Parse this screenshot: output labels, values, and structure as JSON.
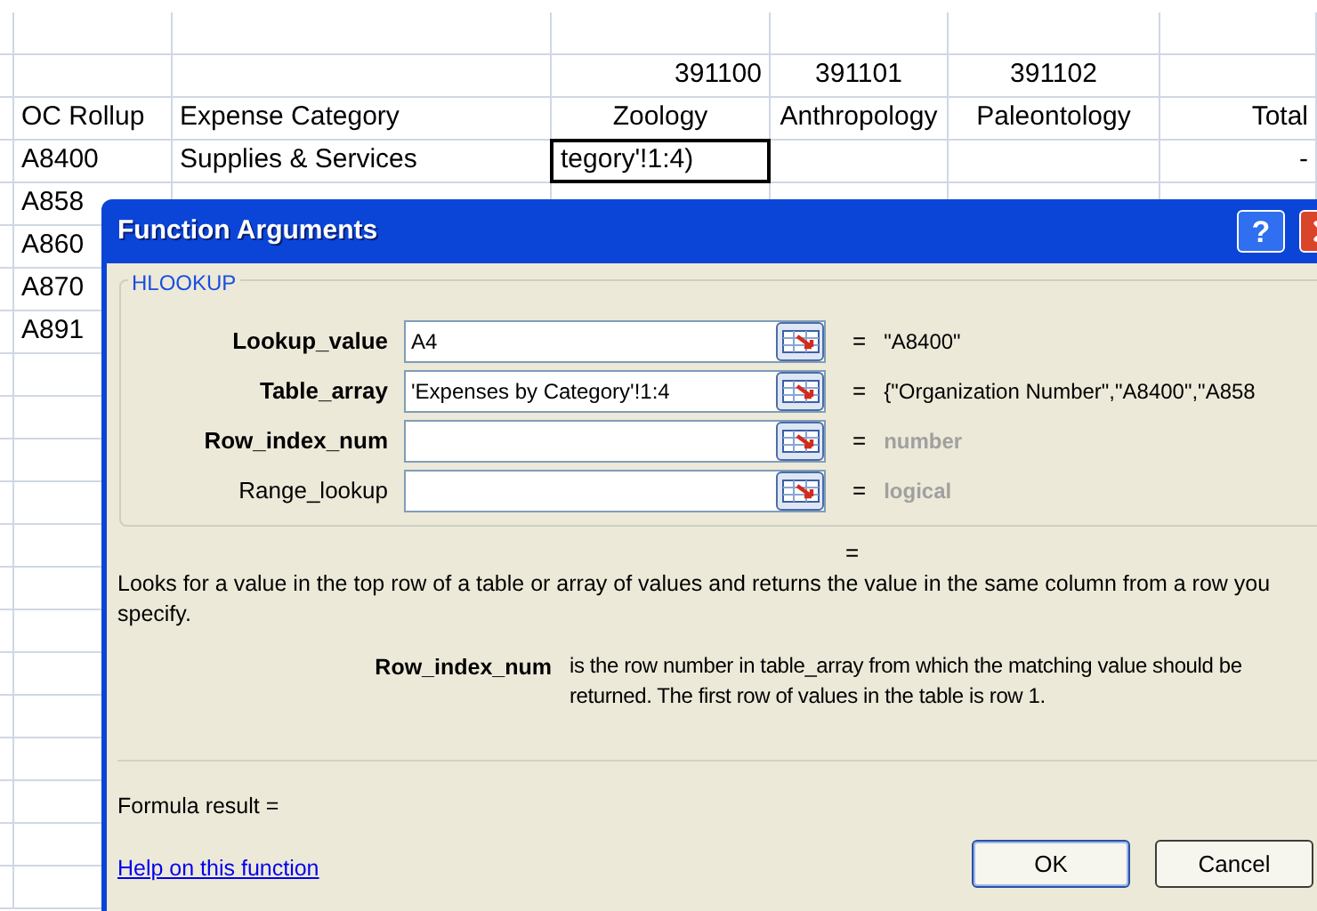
{
  "sheet": {
    "rows": [
      {
        "kind": "ids",
        "cells": {
          "col_3": {
            "text": "391100",
            "selected": false
          },
          "col_4": {
            "text": "391101",
            "selected": false
          },
          "col_5": {
            "text": "391102",
            "selected": false
          }
        }
      },
      {
        "kind": "header",
        "cells": {
          "col_1": {
            "text": "OC Rollup",
            "selected": false
          },
          "col_2": {
            "text": "Expense Category",
            "selected": false
          },
          "col_3": {
            "text": "Zoology",
            "selected": false
          },
          "col_4": {
            "text": "Anthropology",
            "selected": false
          },
          "col_5": {
            "text": "Paleontology",
            "selected": false
          },
          "col_6": {
            "text": "Total",
            "selected": false
          }
        }
      },
      {
        "kind": "data",
        "cells": {
          "col_1": {
            "text": "A8400",
            "selected": false
          },
          "col_2": {
            "text": "Supplies & Services",
            "selected": false
          },
          "col_3": {
            "text": "tegory'!1:4)",
            "selected": true
          },
          "col_6": {
            "text": "-",
            "selected": false
          }
        }
      },
      {
        "kind": "data",
        "cells": {
          "col_1": {
            "text": "A858",
            "selected": false
          }
        }
      },
      {
        "kind": "data",
        "cells": {
          "col_1": {
            "text": "A860",
            "selected": false
          }
        }
      },
      {
        "kind": "data",
        "cells": {
          "col_1": {
            "text": "A870",
            "selected": false
          }
        }
      },
      {
        "kind": "data",
        "cells": {
          "col_1": {
            "text": "A891",
            "selected": false
          }
        }
      }
    ]
  },
  "dialog": {
    "title": "Function Arguments",
    "help_button": "?",
    "group_title": "HLOOKUP",
    "arguments": [
      {
        "label": "Lookup_value",
        "required": true,
        "value": "A4",
        "equals": "=",
        "result": "\"A8400\"",
        "dimmed": false
      },
      {
        "label": "Table_array",
        "required": true,
        "value": "'Expenses by Category'!1:4",
        "equals": "=",
        "result": "{\"Organization Number\",\"A8400\",\"A858",
        "dimmed": false
      },
      {
        "label": "Row_index_num",
        "required": true,
        "equals": "=",
        "result": "number",
        "dimmed": true
      },
      {
        "label": "Range_lookup",
        "required": false,
        "equals": "=",
        "result": "logical",
        "dimmed": true
      }
    ],
    "function_result": "=",
    "description": "Looks for a value in the top row of a table or array of values and returns the value in the same column from a row you specify.",
    "argument_help": {
      "name": "Row_index_num",
      "text": "is the row number in table_array from which the matching value should be returned. The first row of values in the table is row 1."
    },
    "formula_result": "Formula result =",
    "help_link": "Help on this function",
    "buttons": [
      "OK",
      "Cancel"
    ]
  }
}
